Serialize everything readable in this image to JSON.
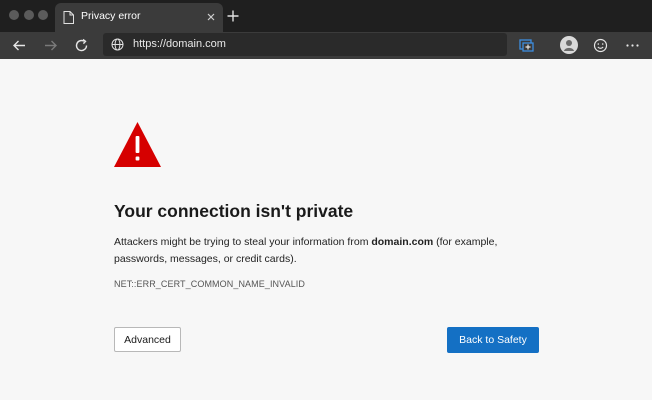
{
  "window": {
    "tab_title": "Privacy error",
    "address": "https://domain.com"
  },
  "icons": {
    "tab": "page-icon",
    "close": "close-icon",
    "new_tab": "plus-icon",
    "back": "arrow-left-icon",
    "forward": "arrow-right-icon",
    "reload": "reload-icon",
    "site": "globe-icon",
    "collections": "collections-icon",
    "profile": "profile-icon",
    "feedback": "smiley-icon",
    "menu": "more-icon",
    "warning": "warning-triangle-icon"
  },
  "error": {
    "title": "Your connection isn't private",
    "desc_pre": "Attackers might be trying to steal your information from ",
    "desc_domain": "domain.com",
    "desc_post": " (for example, passwords, messages, or credit cards).",
    "code": "NET::ERR_CERT_COMMON_NAME_INVALID"
  },
  "buttons": {
    "advanced": "Advanced",
    "back_to_safety": "Back to Safety"
  },
  "colors": {
    "accent": "#1470c4",
    "warning": "#d60000",
    "chrome_dark": "#1f1f1f",
    "toolbar": "#3b3b3b"
  }
}
